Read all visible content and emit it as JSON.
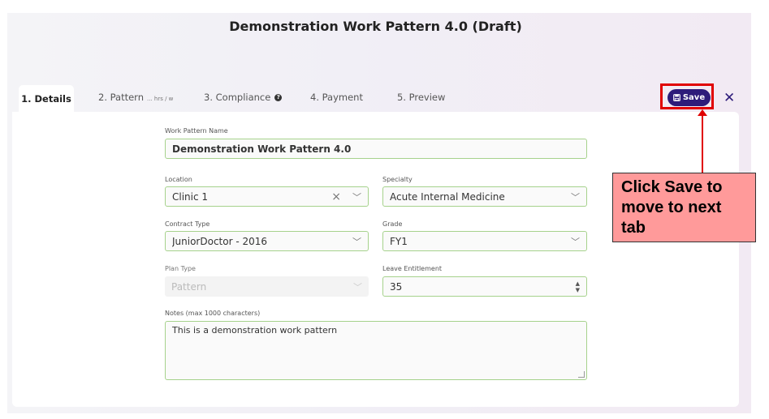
{
  "page": {
    "title": "Demonstration Work Pattern 4.0 (Draft)"
  },
  "tabs": [
    {
      "label": "1. Details"
    },
    {
      "label": "2. Pattern",
      "suffix": "... hrs / w"
    },
    {
      "label": "3. Compliance",
      "help": "?"
    },
    {
      "label": "4. Payment"
    },
    {
      "label": "5. Preview"
    }
  ],
  "toolbar": {
    "save_label": "Save",
    "close_glyph": "✕"
  },
  "form": {
    "name": {
      "label": "Work Pattern Name",
      "value": "Demonstration Work Pattern 4.0"
    },
    "location": {
      "label": "Location",
      "value": "Clinic 1"
    },
    "specialty": {
      "label": "Specialty",
      "value": "Acute Internal Medicine"
    },
    "contract_type": {
      "label": "Contract Type",
      "value": "JuniorDoctor - 2016"
    },
    "grade": {
      "label": "Grade",
      "value": "FY1"
    },
    "plan_type": {
      "label": "Plan Type",
      "value": "Pattern"
    },
    "leave": {
      "label": "Leave Entitlement",
      "value": "35"
    },
    "notes": {
      "label": "Notes (max 1000 characters)",
      "value": "This is a demonstration work pattern"
    }
  },
  "annotation": {
    "text": "Click Save to move to next tab",
    "color": "#ff9a9a",
    "border_color": "#e00000"
  },
  "colors": {
    "accent": "#2e1c7a",
    "field_border": "#a6d28c"
  }
}
